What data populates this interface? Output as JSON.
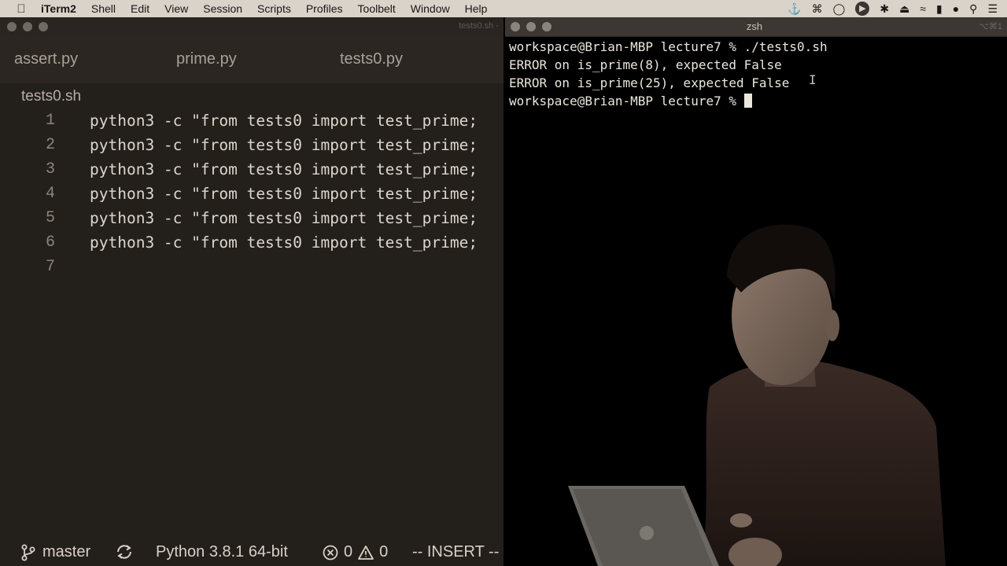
{
  "menubar": {
    "app_name": "iTerm2",
    "items": [
      "Shell",
      "Edit",
      "View",
      "Session",
      "Scripts",
      "Profiles",
      "Toolbelt",
      "Window",
      "Help"
    ],
    "status_icons": [
      "docker-icon",
      "command-icon",
      "glasses-icon",
      "play-icon",
      "bluetooth-icon",
      "eject-icon",
      "wifi-icon",
      "battery-icon",
      "user-icon",
      "search-icon",
      "list-icon"
    ]
  },
  "editor": {
    "window_title": "tests0.sh -",
    "tabs": [
      {
        "label": "assert.py"
      },
      {
        "label": "prime.py"
      },
      {
        "label": "tests0.py"
      }
    ],
    "breadcrumb": "tests0.sh",
    "lines": [
      {
        "num": "1",
        "code": "python3 -c \"from tests0 import test_prime;"
      },
      {
        "num": "2",
        "code": "python3 -c \"from tests0 import test_prime;"
      },
      {
        "num": "3",
        "code": "python3 -c \"from tests0 import test_prime;"
      },
      {
        "num": "4",
        "code": "python3 -c \"from tests0 import test_prime;"
      },
      {
        "num": "5",
        "code": "python3 -c \"from tests0 import test_prime;"
      },
      {
        "num": "6",
        "code": "python3 -c \"from tests0 import test_prime;"
      },
      {
        "num": "7",
        "code": ""
      }
    ],
    "statusbar": {
      "branch": "master",
      "python": "Python 3.8.1 64-bit",
      "errors": "0",
      "warnings": "0",
      "mode": "-- INSERT --"
    }
  },
  "terminal": {
    "window_title": "zsh",
    "shortcut": "⌥⌘1",
    "lines": [
      "workspace@Brian-MBP lecture7 % ./tests0.sh",
      "ERROR on is_prime(8), expected False",
      "ERROR on is_prime(25), expected False",
      "workspace@Brian-MBP lecture7 % "
    ]
  },
  "colors": {
    "editor_bg": "#231f1b",
    "tab_bar_bg": "#2b2621",
    "terminal_bg": "#000000",
    "menubar_bg": "#d9d3ca",
    "text": "#ddd6cc"
  }
}
